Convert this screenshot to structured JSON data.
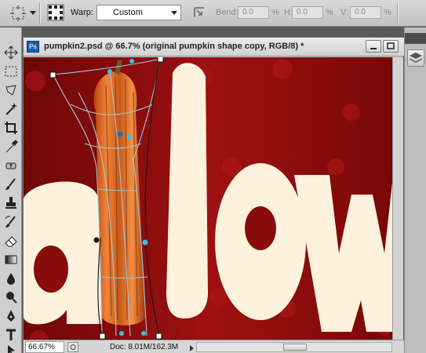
{
  "options_bar": {
    "warp_label": "Warp:",
    "warp_value": "Custom",
    "bend_label": "Bend:",
    "bend_value": "0.0",
    "bend_unit": "%",
    "h_label": "H:",
    "h_value": "0.0",
    "h_unit": "%",
    "v_label": "V:",
    "v_value": "0.0",
    "v_unit": "%"
  },
  "document": {
    "badge": "Ps",
    "title": "pumpkin2.psd @ 66.7% (original pumpkin shape copy, RGB/8) *"
  },
  "status_bar": {
    "zoom": "66.67%",
    "doc_info": "Doc: 8.01M/162.3M"
  },
  "colors": {
    "canvas_red": "#8a0b0b",
    "letter_fill": "#fff2dc",
    "handle_cyan": "#36c2e6",
    "warp_mesh": "#9fc6d8"
  },
  "icons": [
    "tool-preset-icon",
    "warp-grid-icon",
    "change-orientation-icon",
    "move-tool-icon",
    "marquee-tool-icon",
    "lasso-tool-icon",
    "magic-wand-icon",
    "crop-tool-icon",
    "eyedropper-icon",
    "healing-brush-icon",
    "brush-tool-icon",
    "clone-stamp-icon",
    "history-brush-icon",
    "eraser-icon",
    "gradient-tool-icon",
    "blur-tool-icon",
    "dodge-tool-icon",
    "pen-tool-icon",
    "type-tool-icon",
    "path-selection-icon",
    "layers-panel-icon"
  ]
}
